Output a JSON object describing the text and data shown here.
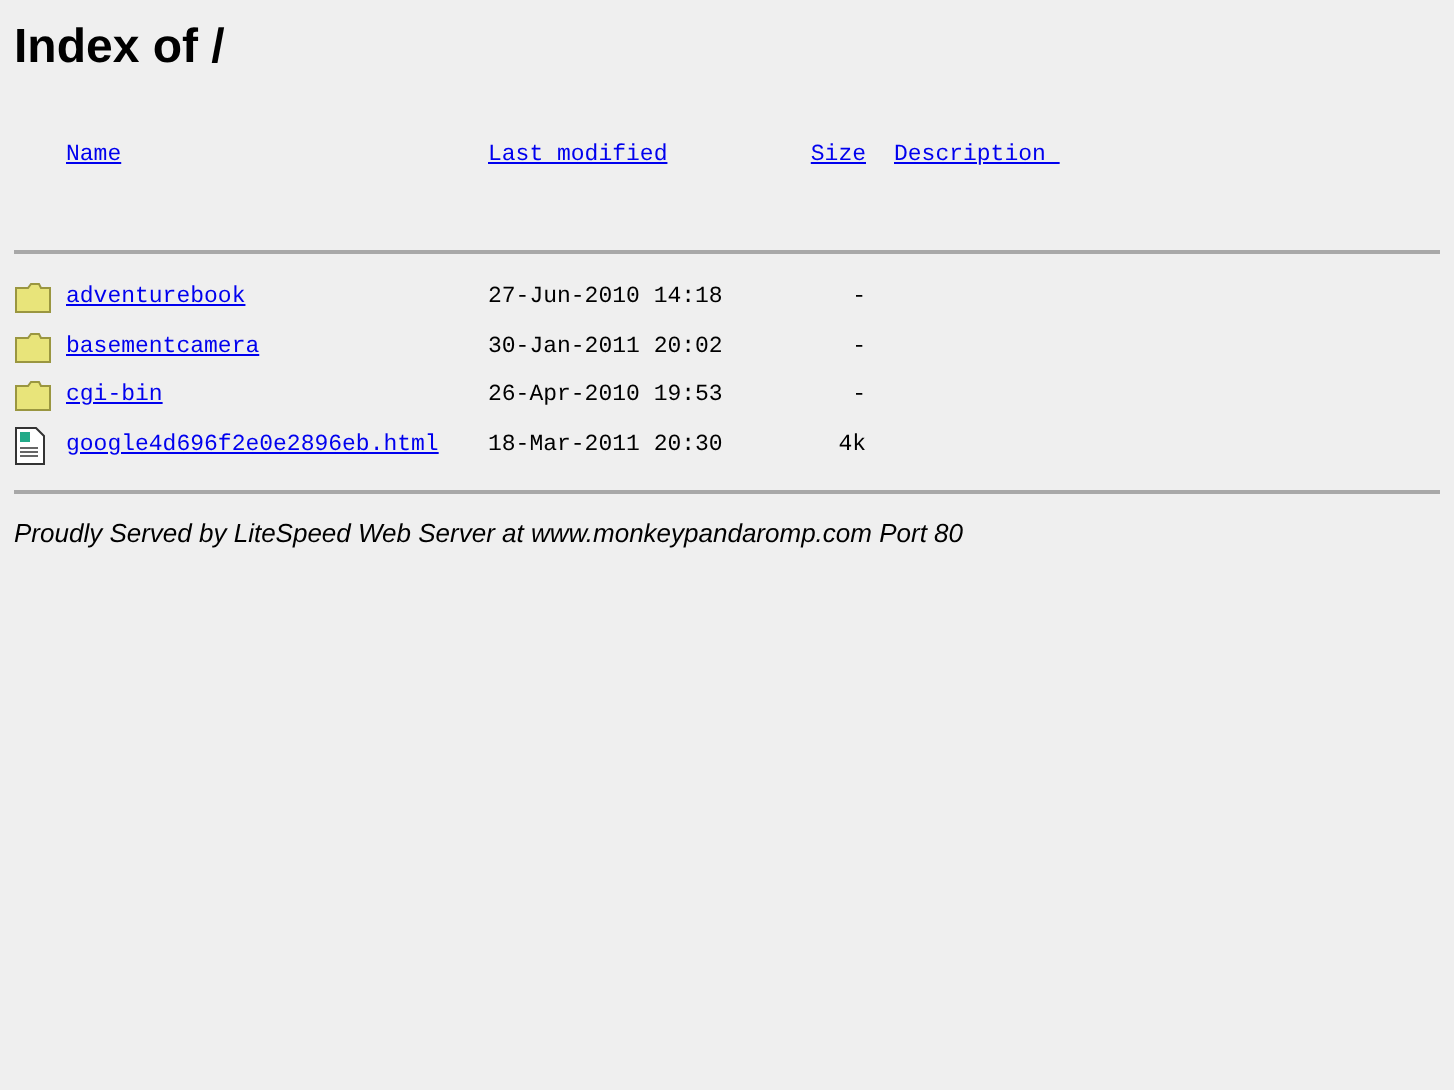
{
  "title": "Index of /",
  "columns": [
    "Name",
    "Last modified",
    "Size",
    "Description "
  ],
  "entries": [
    {
      "kind": "folder",
      "name": "adventurebook",
      "modified": "27-Jun-2010 14:18",
      "size": "-"
    },
    {
      "kind": "folder",
      "name": "basementcamera",
      "modified": "30-Jan-2011 20:02",
      "size": "-"
    },
    {
      "kind": "folder",
      "name": "cgi-bin",
      "modified": "26-Apr-2010 19:53",
      "size": "-"
    },
    {
      "kind": "file",
      "name": "google4d696f2e0e2896eb.html",
      "modified": "18-Mar-2011 20:30",
      "size": "4k"
    }
  ],
  "footer": "Proudly Served by LiteSpeed Web Server at www.monkeypandaromp.com Port 80"
}
